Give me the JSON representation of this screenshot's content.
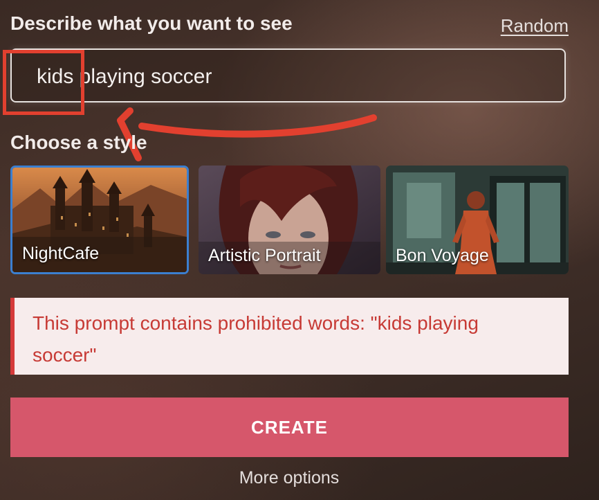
{
  "describe_label": "Describe what you want to see",
  "random_link": "Random",
  "prompt": {
    "value": "kids playing soccer"
  },
  "style_section": {
    "label": "Choose a style",
    "cards": [
      {
        "name": "NightCafe",
        "selected": true
      },
      {
        "name": "Artistic Portrait",
        "selected": false
      },
      {
        "name": "Bon Voyage",
        "selected": false
      }
    ]
  },
  "error_message": "This prompt contains prohibited words: \"kids playing soccer\"",
  "create_button": "CREATE",
  "more_options": "More options",
  "colors": {
    "annotation_red": "#e2402f",
    "selected_border": "#3b7fd0",
    "create_button": "#d6576b",
    "error_text": "#c73a35",
    "error_bg": "#f7ecec"
  }
}
